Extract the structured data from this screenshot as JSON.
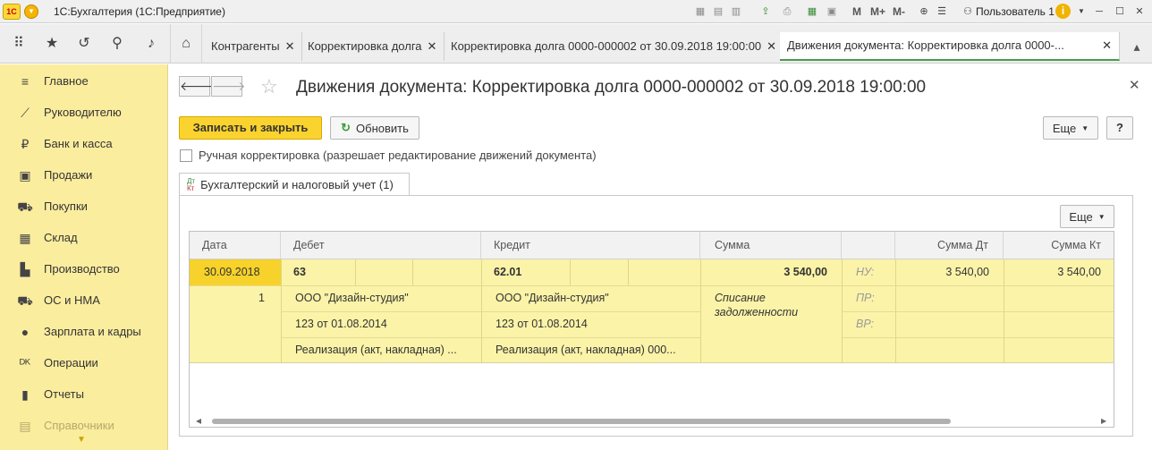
{
  "app": {
    "title": "1С:Бухгалтерия  (1С:Предприятие)",
    "logo": "1С",
    "user": "Пользователь 1",
    "toolbar_text": [
      "M",
      "M+",
      "M-"
    ]
  },
  "tabs": [
    {
      "label": "Контрагенты",
      "close": "✕"
    },
    {
      "label": "Корректировка долга",
      "close": "✕"
    },
    {
      "label": "Корректировка долга 0000-000002 от 30.09.2018 19:00:00",
      "close": "✕"
    },
    {
      "label": "Движения документа: Корректировка долга 0000-...",
      "close": "✕",
      "active": true
    }
  ],
  "sidebar": {
    "items": [
      {
        "label": "Главное",
        "icon": "menu-icon"
      },
      {
        "label": "Руководителю",
        "icon": "chart-line-icon"
      },
      {
        "label": "Банк и касса",
        "icon": "ruble-icon"
      },
      {
        "label": "Продажи",
        "icon": "cart-bag-icon"
      },
      {
        "label": "Покупки",
        "icon": "cart-icon"
      },
      {
        "label": "Склад",
        "icon": "warehouse-icon"
      },
      {
        "label": "Производство",
        "icon": "factory-icon"
      },
      {
        "label": "ОС и НМА",
        "icon": "truck-icon"
      },
      {
        "label": "Зарплата и кадры",
        "icon": "person-icon"
      },
      {
        "label": "Операции",
        "icon": "dt-kt-icon"
      },
      {
        "label": "Отчеты",
        "icon": "bar-chart-icon"
      },
      {
        "label": "Справочники",
        "icon": "book-icon"
      }
    ]
  },
  "document": {
    "title": "Движения документа: Корректировка долга 0000-000002 от 30.09.2018 19:00:00",
    "save_close_label": "Записать и закрыть",
    "refresh_label": "Обновить",
    "more_label": "Еще",
    "help_label": "?",
    "manual_correction_label": "Ручная корректировка (разрешает редактирование движений документа)",
    "manual_correction_checked": false,
    "subtab_label": "Бухгалтерский и налоговый учет (1)",
    "subtab_icon_top": "Дт",
    "subtab_icon_bottom": "Кт",
    "grid_more_label": "Еще"
  },
  "grid": {
    "headers": [
      "Дата",
      "Дебет",
      "Кредит",
      "Сумма",
      "",
      "Сумма Дт",
      "Сумма Кт"
    ],
    "row": {
      "date": "30.09.2018",
      "line_no": "1",
      "debit_account": "63",
      "credit_account": "62.01",
      "amount": "3 540,00",
      "debit_subconto": [
        "ООО \"Дизайн-студия\"",
        "123 от 01.08.2014",
        "Реализация (акт, накладная) ..."
      ],
      "credit_subconto": [
        "ООО \"Дизайн-студия\"",
        "123 от 01.08.2014",
        "Реализация (акт, накладная) 000..."
      ],
      "content": "Списание задолженности",
      "tax_labels": [
        "НУ:",
        "ПР:",
        "ВР:"
      ],
      "amount_dt_nu": "3 540,00",
      "amount_kt_nu": "3 540,00"
    }
  }
}
